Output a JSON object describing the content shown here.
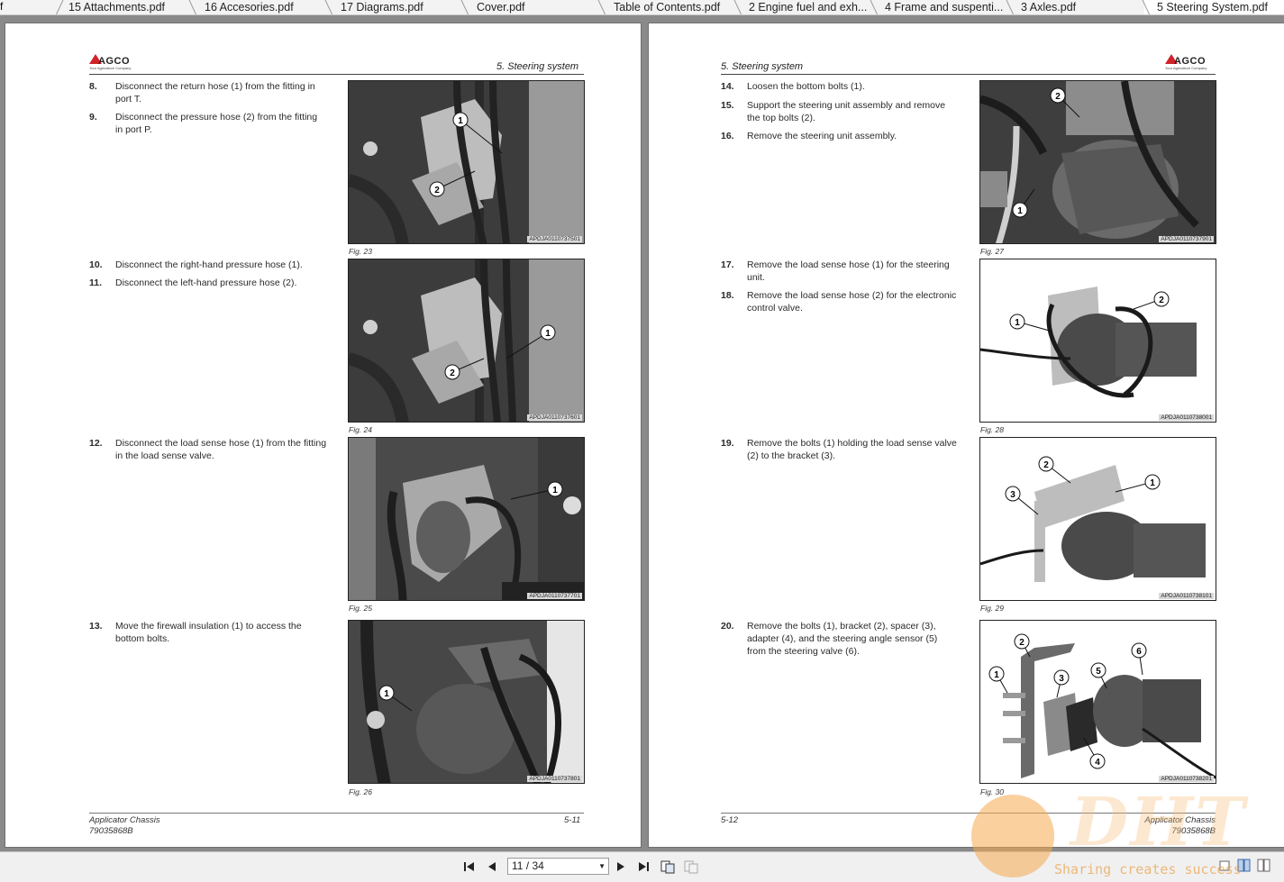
{
  "tabs": [
    {
      "label": "15 Attachments.pdf"
    },
    {
      "label": "16 Accesories.pdf"
    },
    {
      "label": "17 Diagrams.pdf"
    },
    {
      "label": "Cover.pdf"
    },
    {
      "label": "Table of Contents.pdf"
    },
    {
      "label": "2 Engine fuel and exh..."
    },
    {
      "label": "4 Frame and suspenti..."
    },
    {
      "label": "3 Axles.pdf"
    },
    {
      "label": "5 Steering System.pdf"
    }
  ],
  "left_page": {
    "logo_text": "AGCO",
    "logo_tagline": "Your Agriculture Company",
    "section_title": "5. Steering system",
    "steps": [
      {
        "num": "8.",
        "text": "Disconnect the return hose (1) from the fitting in port T."
      },
      {
        "num": "9.",
        "text": "Disconnect the pressure hose (2) from the fitting in port P."
      },
      {
        "num": "10.",
        "text": "Disconnect the right-hand pressure hose (1)."
      },
      {
        "num": "11.",
        "text": "Disconnect the left-hand pressure hose (2)."
      },
      {
        "num": "12.",
        "text": "Disconnect the load sense hose (1) from the fitting in the load sense valve."
      },
      {
        "num": "13.",
        "text": "Move the firewall insulation (1) to access the bottom bolts."
      }
    ],
    "figures": [
      {
        "label": "Fig. 23",
        "code": "APDJA0110737501"
      },
      {
        "label": "Fig. 24",
        "code": "APDJA0110737601"
      },
      {
        "label": "Fig. 25",
        "code": "APDJA0110737701"
      },
      {
        "label": "Fig. 26",
        "code": "APDJA0110737801"
      }
    ],
    "footer_title": "Applicator Chassis",
    "footer_doc": "79035868B",
    "page_number": "5-11"
  },
  "right_page": {
    "logo_text": "AGCO",
    "logo_tagline": "Your Agriculture Company",
    "section_title": "5. Steering system",
    "steps": [
      {
        "num": "14.",
        "text": "Loosen the bottom bolts (1)."
      },
      {
        "num": "15.",
        "text": "Support the steering unit assembly and remove the top bolts (2)."
      },
      {
        "num": "16.",
        "text": "Remove the steering unit assembly."
      },
      {
        "num": "17.",
        "text": "Remove the load sense hose (1) for the steering unit."
      },
      {
        "num": "18.",
        "text": "Remove the load sense hose (2) for the electronic control valve."
      },
      {
        "num": "19.",
        "text": "Remove the bolts (1) holding the load sense valve (2) to the bracket (3)."
      },
      {
        "num": "20.",
        "text": "Remove the bolts (1), bracket (2), spacer (3), adapter (4), and the steering angle sensor (5) from the steering valve (6)."
      }
    ],
    "figures": [
      {
        "label": "Fig. 27",
        "code": "APDJA0110737901"
      },
      {
        "label": "Fig. 28",
        "code": "APDJA0110738001"
      },
      {
        "label": "Fig. 29",
        "code": "APDJA0110738101"
      },
      {
        "label": "Fig. 30",
        "code": "APDJA0110738201"
      }
    ],
    "footer_title": "Applicator Chassis",
    "footer_doc": "79035868B",
    "page_number": "5-12"
  },
  "toolbar": {
    "page_indicator": "11 / 34"
  },
  "watermark": {
    "big_text": "DHT",
    "small_text": "Sharing creates success"
  },
  "colors": {
    "brand_red": "#d2232a",
    "viewer_background": "#8a8a8a"
  }
}
